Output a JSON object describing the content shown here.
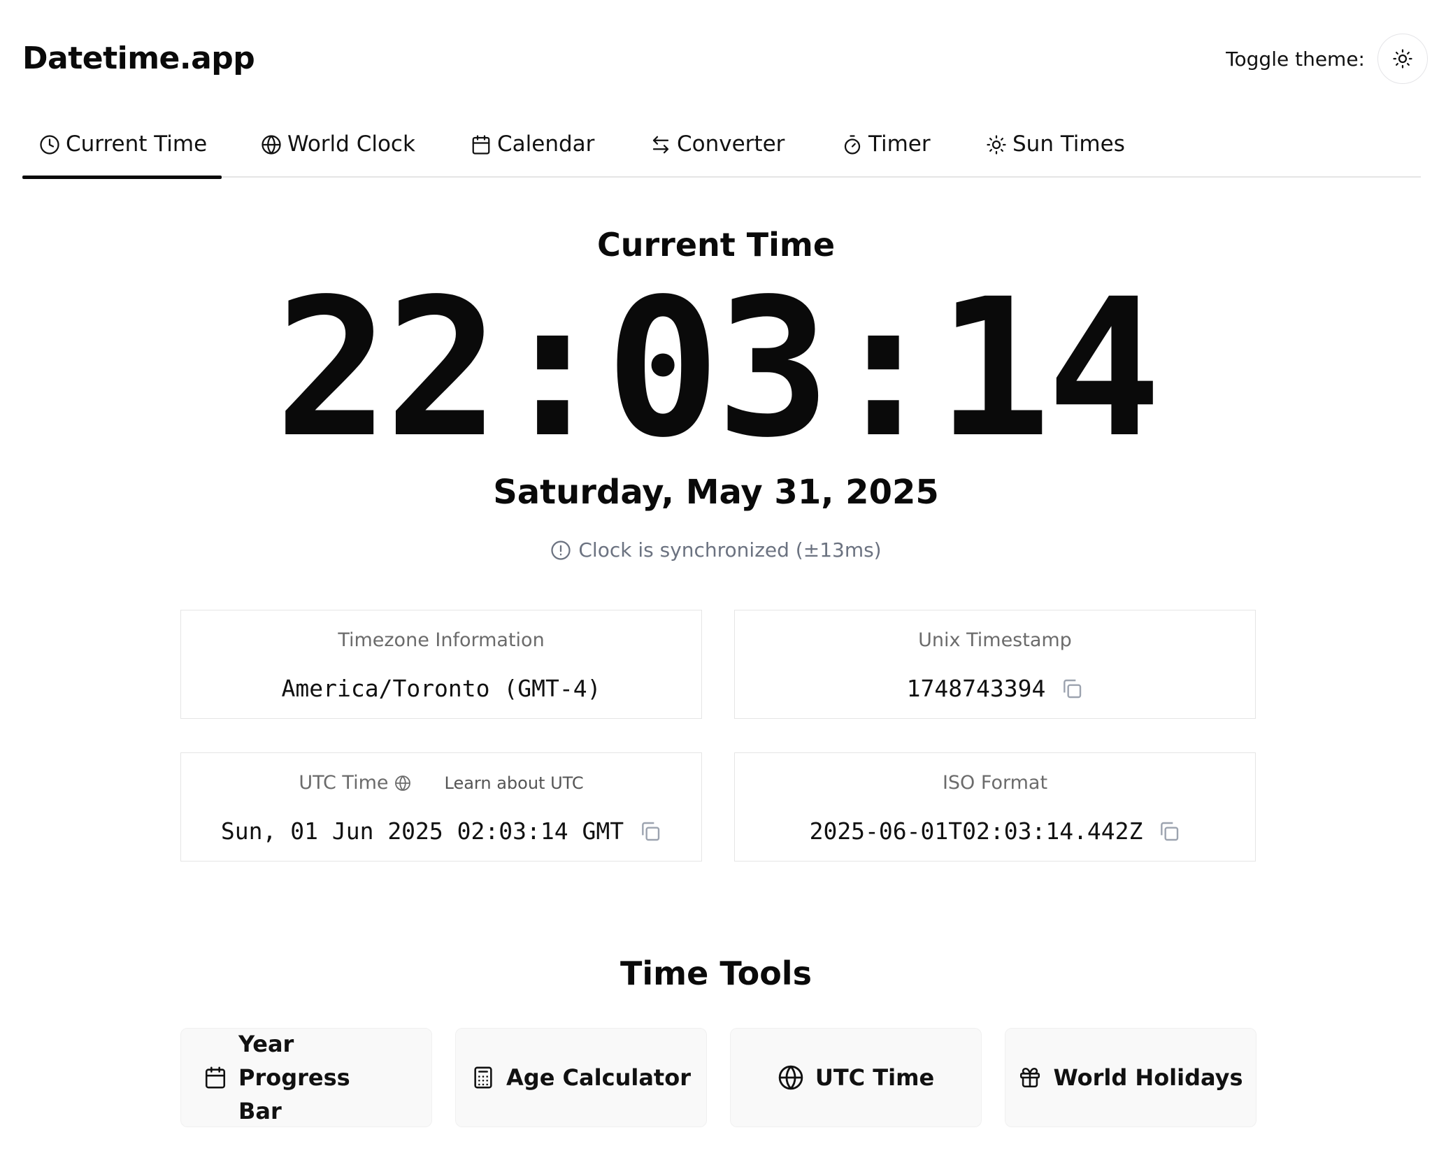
{
  "header": {
    "brand": "Datetime.app",
    "toggle_theme_label": "Toggle theme:"
  },
  "tabs": [
    {
      "label": "Current Time",
      "icon": "clock-icon",
      "active": true
    },
    {
      "label": "World Clock",
      "icon": "globe-icon",
      "active": false
    },
    {
      "label": "Calendar",
      "icon": "calendar-icon",
      "active": false
    },
    {
      "label": "Converter",
      "icon": "swap-arrows-icon",
      "active": false
    },
    {
      "label": "Timer",
      "icon": "stopwatch-icon",
      "active": false
    },
    {
      "label": "Sun Times",
      "icon": "sun-icon",
      "active": false
    }
  ],
  "current": {
    "title": "Current Time",
    "time": "22:03:14",
    "date": "Saturday, May 31, 2025",
    "sync_status": "Clock is synchronized (±13ms)"
  },
  "cards": {
    "timezone": {
      "label": "Timezone Information",
      "value": "America/Toronto (GMT-4)"
    },
    "unix": {
      "label": "Unix Timestamp",
      "value": "1748743394"
    },
    "utc": {
      "label": "UTC Time",
      "link": "Learn about UTC",
      "value": "Sun, 01 Jun 2025 02:03:14 GMT"
    },
    "iso": {
      "label": "ISO Format",
      "value": "2025-06-01T02:03:14.442Z"
    }
  },
  "tools": {
    "title": "Time Tools",
    "items": [
      {
        "label": "Year Progress Bar",
        "icon": "calendar-icon"
      },
      {
        "label": "Age Calculator",
        "icon": "calculator-icon"
      },
      {
        "label": "UTC Time",
        "icon": "globe-icon"
      },
      {
        "label": "World Holidays",
        "icon": "gift-icon"
      }
    ]
  },
  "colors": {
    "text": "#0a0a0a",
    "muted": "#6b7280",
    "border": "#e5e5e5",
    "tool_bg": "#f9f9f9"
  }
}
